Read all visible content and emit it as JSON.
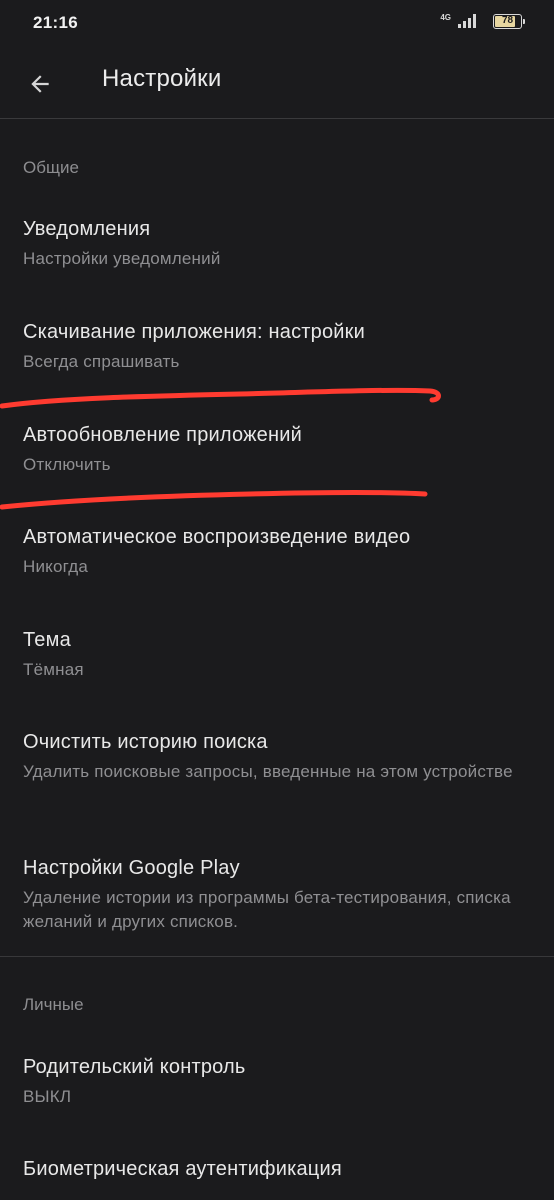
{
  "status_bar": {
    "time": "21:16",
    "network": "4G",
    "battery_level": "78",
    "battery_fraction": 0.78
  },
  "app_bar": {
    "title": "Настройки",
    "back_icon": "arrow-back-icon"
  },
  "sections": {
    "general": {
      "header": "Общие"
    },
    "personal": {
      "header": "Личные"
    }
  },
  "items": {
    "notifications": {
      "title": "Уведомления",
      "subtitle": "Настройки уведомлений"
    },
    "app_download": {
      "title": "Скачивание приложения: настройки",
      "subtitle": "Всегда спрашивать"
    },
    "auto_update": {
      "title": "Автообновление приложений",
      "subtitle": "Отключить"
    },
    "autoplay": {
      "title": "Автоматическое воспроизведение видео",
      "subtitle": "Никогда"
    },
    "theme": {
      "title": "Тема",
      "subtitle": "Тёмная"
    },
    "clear_history": {
      "title": "Очистить историю поиска",
      "subtitle": "Удалить поисковые запросы, введенные на этом устройстве"
    },
    "google_play": {
      "title": "Настройки Google Play",
      "subtitle": "Удаление истории из программы бета-тестирования, списка желаний и других списков."
    },
    "parental": {
      "title": "Родительский контроль",
      "subtitle": "ВЫКЛ"
    },
    "biometric": {
      "title": "Биометрическая аутентификация"
    }
  },
  "colors": {
    "background": "#1b1b1d",
    "annotation_stroke": "#ff3b30"
  }
}
